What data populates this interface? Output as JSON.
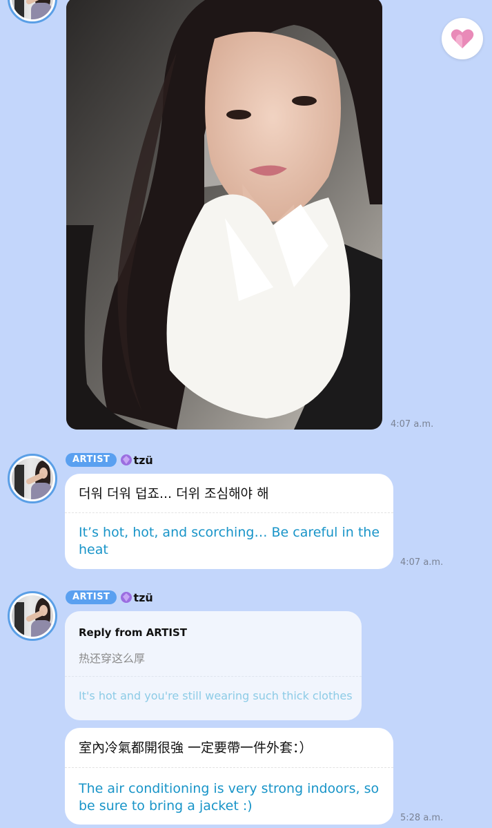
{
  "photo_message": {
    "time": "4:07 a.m."
  },
  "like_button": {
    "icon": "heart-icon",
    "color": "#e77fb0"
  },
  "messages": [
    {
      "badge": "ARTIST",
      "sender": "tzü",
      "original": "더워 더워 덥죠... 더위 조심해야 해",
      "translation": "It’s hot, hot, and scorching… Be careful in the heat",
      "time": "4:07 a.m."
    },
    {
      "badge": "ARTIST",
      "sender": "tzü",
      "reply": {
        "title": "Reply from ARTIST",
        "original": "热还穿这么厚",
        "translation": "It's hot and you're still wearing such thick clothes"
      },
      "original": "室內冷氣都開很強 一定要帶一件外套：）",
      "translation": "The air conditioning is very strong indoors, so be sure to bring a jacket :)",
      "time": "5:28 a.m."
    }
  ],
  "colors": {
    "background": "#c3d6fb",
    "badge": "#5aa0f0",
    "translation_text": "#1894c8",
    "avatar_ring": "#5a9fe6"
  }
}
